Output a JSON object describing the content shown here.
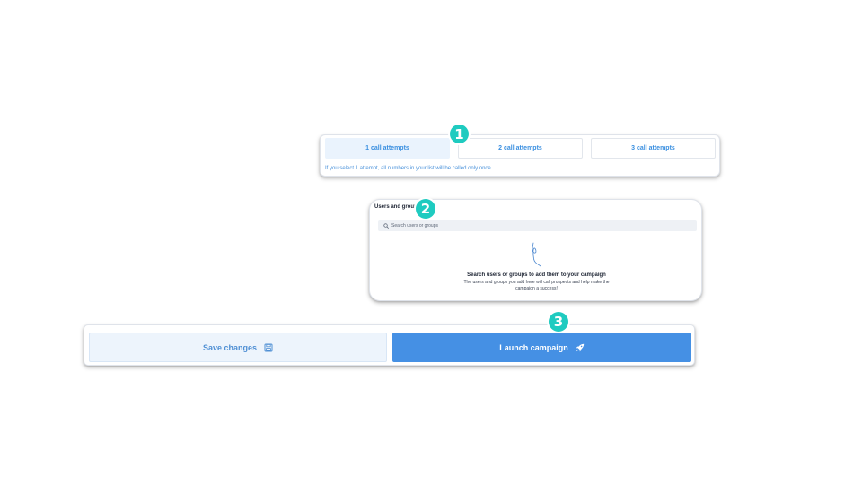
{
  "call_attempts": {
    "options": [
      {
        "label": "1 call attempts",
        "selected": true
      },
      {
        "label": "2 call attempts",
        "selected": false
      },
      {
        "label": "3 call attempts",
        "selected": false
      }
    ],
    "hint": "If you select 1 attempt, all numbers in your list will be called only once."
  },
  "users_groups": {
    "heading": "Users and groups",
    "search_placeholder": "Search users or groups",
    "empty_title": "Search users or groups to add them to your campaign",
    "empty_description": "The users and groups you add here will call prospects and help make the campaign a success!"
  },
  "actions": {
    "save_label": "Save changes",
    "launch_label": "Launch campaign"
  },
  "step_markers": [
    "1",
    "2",
    "3"
  ],
  "icons": {
    "search": "search-icon",
    "illustration": "doodle-illustration-icon",
    "save": "floppy-disk-icon",
    "launch": "rocket-icon"
  },
  "colors": {
    "accent": "#4590e4",
    "accent_light": "#eaf3fd",
    "marker": "#1fcbc0",
    "text_dark": "#1d2433"
  }
}
